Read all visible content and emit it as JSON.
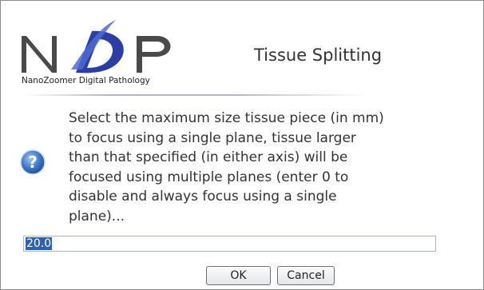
{
  "logo": {
    "letters": [
      "N",
      "P"
    ],
    "caption": "NanoZoomer Digital Pathology",
    "colors": {
      "letters": "#4a4a4a",
      "accent": "#2a3ea6",
      "swoosh": "#4b6bd0"
    }
  },
  "dialog": {
    "title": "Tissue Splitting",
    "message": "Select the maximum size tissue piece (in mm)\nto focus using a single plane, tissue larger\nthan that specified (in either axis) will be\nfocused using multiple planes (enter 0 to\ndisable and always focus using a single\nplane)...",
    "icon": "question-icon",
    "input_value": "20.0",
    "ok_label": "OK",
    "cancel_label": "Cancel"
  },
  "colors": {
    "selection": "#2f62ae",
    "divider": "#b6b0d6",
    "icon_fill": "#3a73c9"
  }
}
